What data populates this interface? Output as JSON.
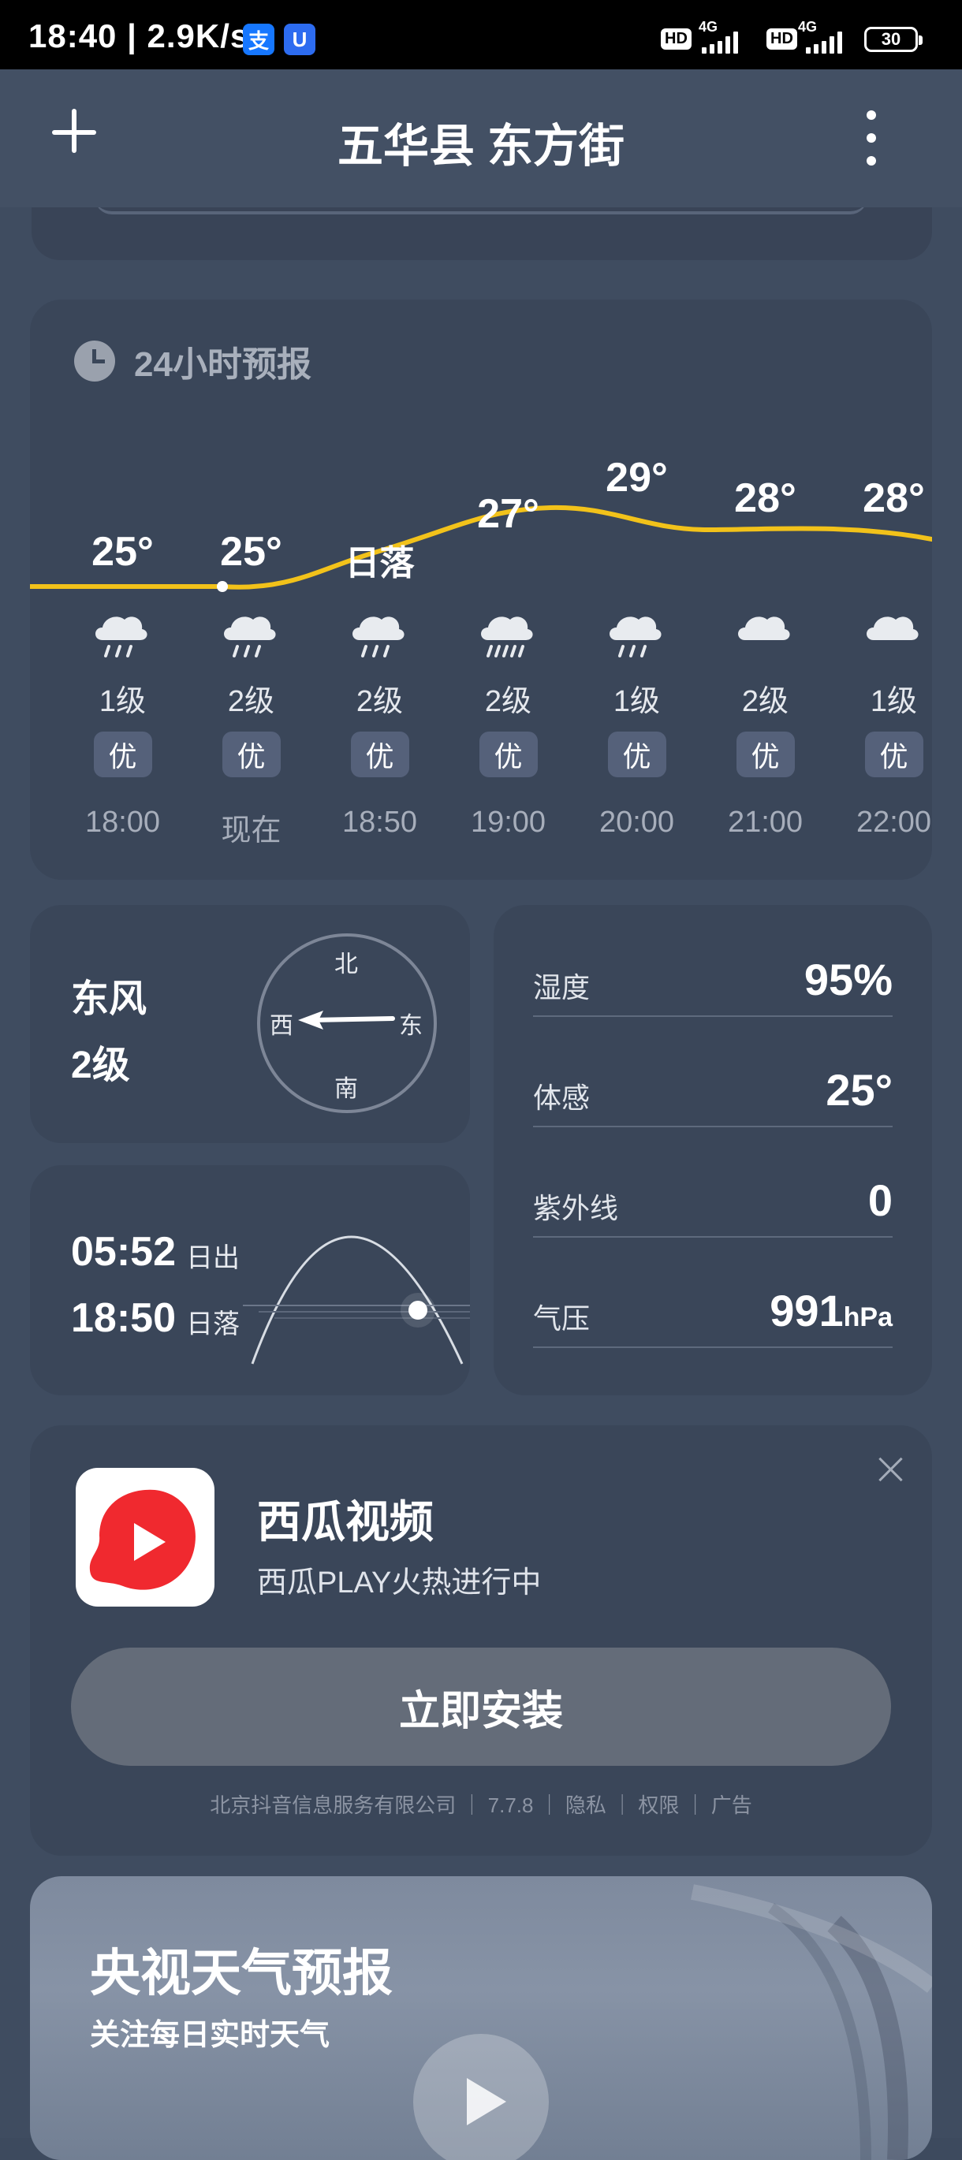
{
  "status_bar": {
    "time": "18:40 | 2.9K/s",
    "icon_1": "支",
    "icon_2": "U",
    "hd_1": "HD",
    "hd_2": "HD",
    "net_1": "4G",
    "net_2": "4G",
    "battery": "30"
  },
  "header": {
    "title": "五华县 东方街"
  },
  "forecast": {
    "heading": "24小时预报",
    "hours": [
      {
        "temp": "25°",
        "level": "1级",
        "aqi": "优",
        "time": "18:00",
        "icon": "rain-cloud-icon"
      },
      {
        "temp": "25°",
        "level": "2级",
        "aqi": "优",
        "time": "现在",
        "icon": "rain-cloud-icon"
      },
      {
        "temp": "日落",
        "level": "2级",
        "aqi": "优",
        "time": "18:50",
        "icon": "rain-cloud-icon"
      },
      {
        "temp": "27°",
        "level": "2级",
        "aqi": "优",
        "time": "19:00",
        "icon": "heavy-rain-cloud-icon"
      },
      {
        "temp": "29°",
        "level": "1级",
        "aqi": "优",
        "time": "20:00",
        "icon": "rain-cloud-icon"
      },
      {
        "temp": "28°",
        "level": "2级",
        "aqi": "优",
        "time": "21:00",
        "icon": "cloud-icon"
      },
      {
        "temp": "28°",
        "level": "1级",
        "aqi": "优",
        "time": "22:00",
        "icon": "cloud-icon"
      }
    ],
    "curve_color": "#f2c21a"
  },
  "wind": {
    "direction": "东风",
    "level": "2级",
    "compass": {
      "n": "北",
      "s": "南",
      "w": "西",
      "e": "东"
    }
  },
  "sun": {
    "rise_time": "05:52",
    "rise_label": "日出",
    "set_time": "18:50",
    "set_label": "日落"
  },
  "details": [
    {
      "label": "湿度",
      "value": "95%",
      "unit": ""
    },
    {
      "label": "体感",
      "value": "25°",
      "unit": ""
    },
    {
      "label": "紫外线",
      "value": "0",
      "unit": ""
    },
    {
      "label": "气压",
      "value": "991",
      "unit": "hPa"
    }
  ],
  "ad": {
    "app_name": "西瓜视频",
    "description": "西瓜PLAY火热进行中",
    "install_label": "立即安装",
    "footer": "北京抖音信息服务有限公司 ｜ 7.7.8 ｜ 隐私 ｜ 权限 ｜ 广告",
    "logo_color": "#f0292f"
  },
  "video": {
    "title": "央视天气预报",
    "subtitle": "关注每日实时天气"
  }
}
